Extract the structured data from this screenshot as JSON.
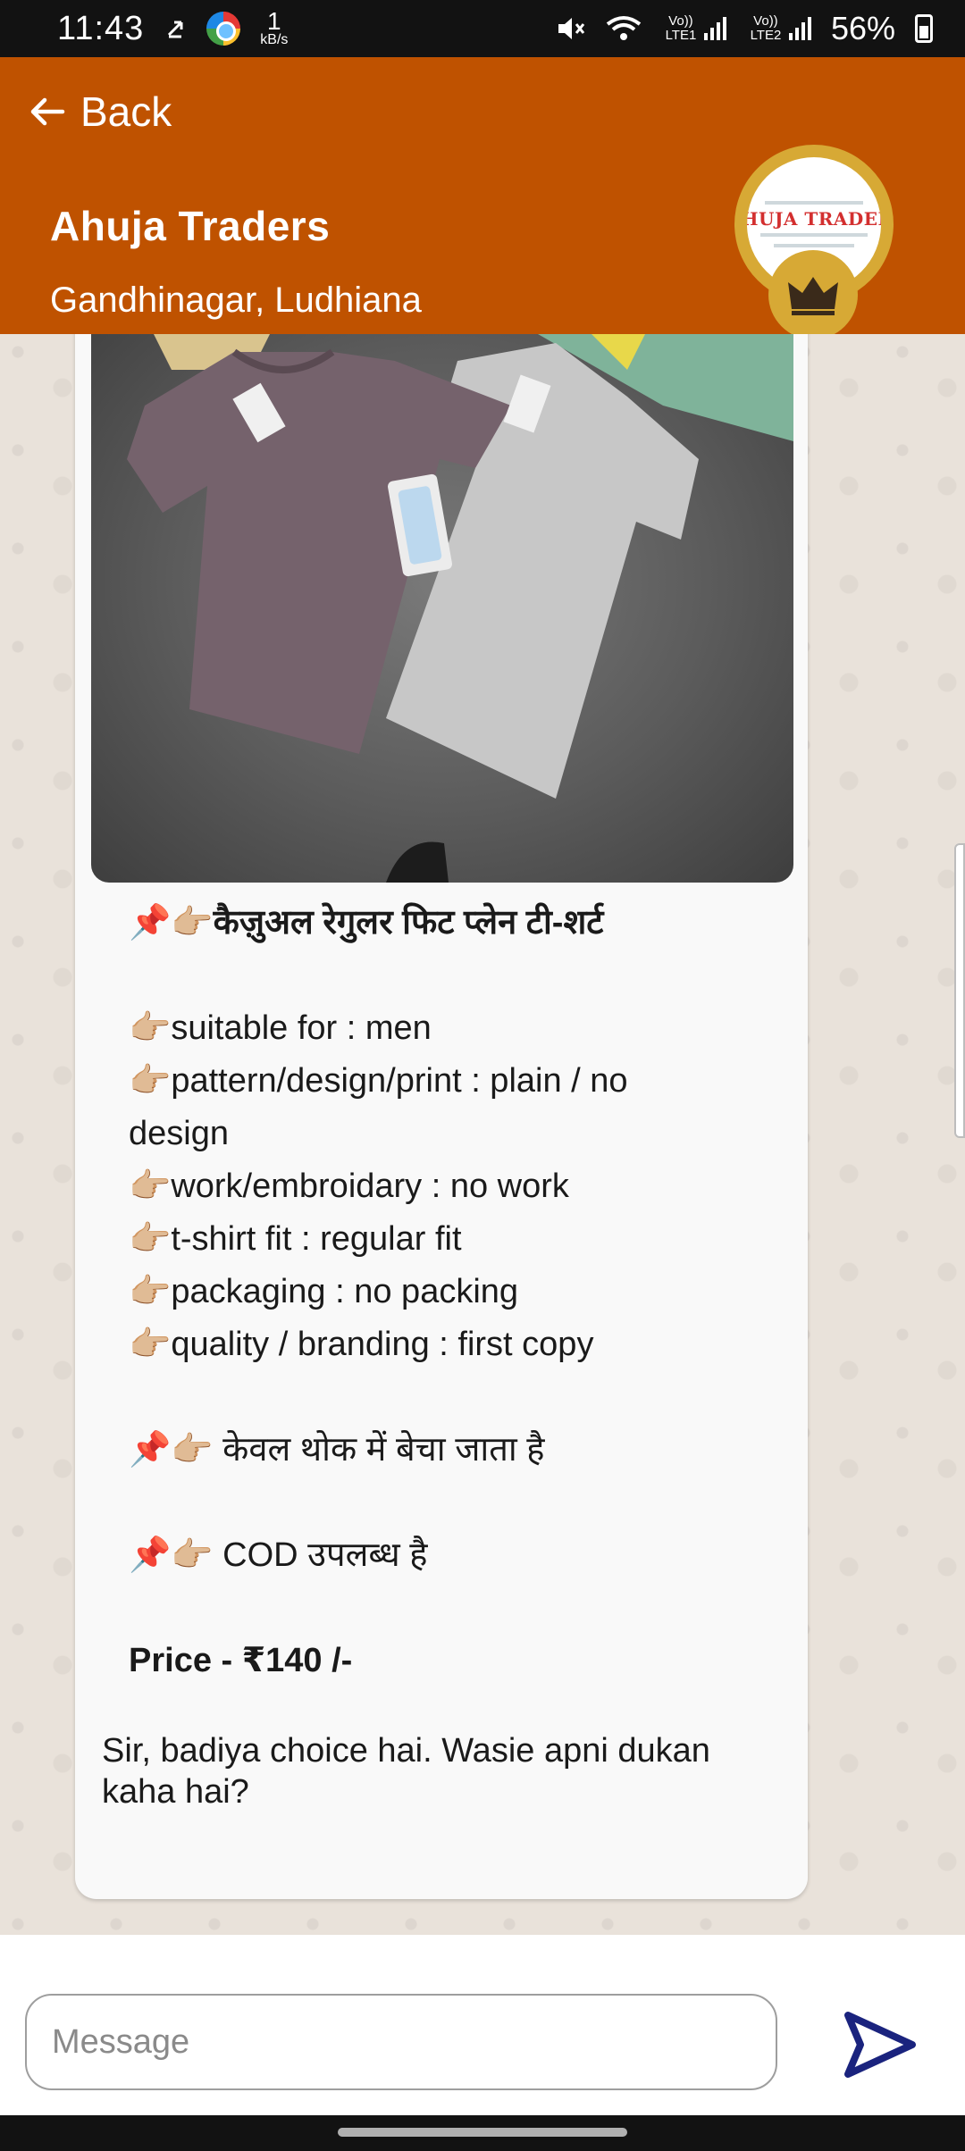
{
  "status_bar": {
    "time": "11:43",
    "data_speed_value": "1",
    "data_speed_unit": "kB/s",
    "sim1_label": "Vo)) LTE1",
    "sim2_label": "Vo)) LTE2",
    "battery": "56%"
  },
  "header": {
    "back_label": "Back",
    "shop_name": "Ahuja Traders",
    "location": "Gandhinagar, Ludhiana",
    "avatar_text": "HUJA TRADEI"
  },
  "message": {
    "lines": {
      "title": "📌👉🏼कैज़ुअल रेगुलर फिट प्लेन टी-शर्ट",
      "l1": "👉🏼suitable for : men",
      "l2": "👉🏼pattern/design/print : plain / no",
      "l2b": "design",
      "l3": "👉🏼work/embroidary : no work",
      "l4": "👉🏼t-shirt fit : regular fit",
      "l5": "👉🏼packaging : no packing",
      "l6": "👉🏼quality / branding : first copy",
      "wholesale": "📌👉🏼 केवल थोक में बेचा जाता है",
      "cod": "📌👉🏼 COD उपलब्ध है",
      "price": "Price - ₹140 /-"
    },
    "reply": "Sir, badiya choice hai. Wasie apni dukan kaha hai?"
  },
  "input": {
    "placeholder": "Message"
  },
  "colors": {
    "header_bg": "#bf5200",
    "send_icon": "#1a237e",
    "avatar_ring": "#d7a935"
  }
}
